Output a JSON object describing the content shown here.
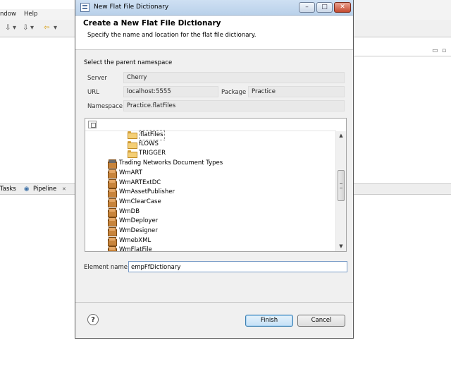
{
  "background": {
    "menu": [
      "ndow",
      "Help"
    ],
    "tabs": {
      "tasks": "Tasks",
      "pipeline": "Pipeline",
      "close_glyph": "✕"
    },
    "toolbar_icons": [
      "⇩",
      "▾",
      "⇩",
      "▾",
      "⇦",
      "▾"
    ],
    "view_icons": [
      "▭",
      "▫"
    ]
  },
  "dialog": {
    "title": "New Flat File Dictionary",
    "window_buttons": {
      "minimize": "–",
      "maximize": "□",
      "close": "✕"
    },
    "header": {
      "title": "Create a New Flat File Dictionary",
      "description": "Specify the name and location for the flat file dictionary."
    },
    "namespace": {
      "section_label": "Select the parent namespace",
      "server_label": "Server",
      "server_value": "Cherry",
      "url_label": "URL",
      "url_value": "localhost:5555",
      "package_label": "Package",
      "package_value": "Practice",
      "namespace_label": "Namespace",
      "namespace_value": "Practice.flatFiles"
    },
    "tree": {
      "items": [
        {
          "label": "flatFiles",
          "type": "folder",
          "selected": true
        },
        {
          "label": "fLOWS",
          "type": "folder",
          "selected": false
        },
        {
          "label": "TRIGGER",
          "type": "folder",
          "selected": false
        },
        {
          "label": "Trading Networks Document Types",
          "type": "package-locked",
          "selected": false
        },
        {
          "label": "WmART",
          "type": "package",
          "selected": false
        },
        {
          "label": "WmARTExtDC",
          "type": "package",
          "selected": false
        },
        {
          "label": "WmAssetPublisher",
          "type": "package",
          "selected": false
        },
        {
          "label": "WmClearCase",
          "type": "package",
          "selected": false
        },
        {
          "label": "WmDB",
          "type": "package",
          "selected": false
        },
        {
          "label": "WmDeployer",
          "type": "package",
          "selected": false
        },
        {
          "label": "WmDesigner",
          "type": "package",
          "selected": false
        },
        {
          "label": "WmebXML",
          "type": "package",
          "selected": false
        },
        {
          "label": "WmFlatFile",
          "type": "package",
          "selected": false
        }
      ],
      "scroll_up": "▲",
      "scroll_down": "▼"
    },
    "element_name": {
      "label": "Element name",
      "value": "empFfDictionary"
    },
    "help_glyph": "?",
    "buttons": {
      "finish": "Finish",
      "cancel": "Cancel"
    },
    "colors": {
      "default_button": "#3c7fb1",
      "title_gradient_top": "#cfe0f3"
    }
  }
}
